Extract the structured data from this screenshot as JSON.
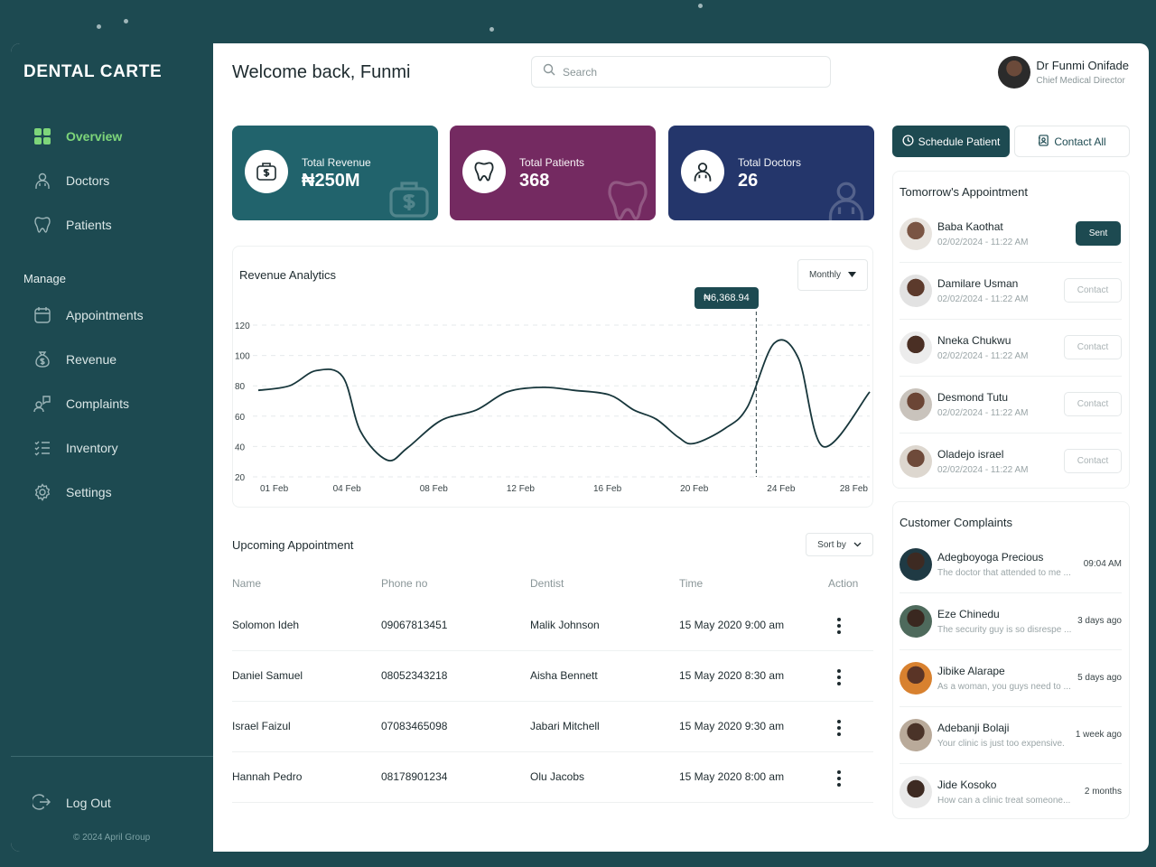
{
  "brand": "DENTAL CARTE",
  "sidebar": {
    "items": [
      {
        "label": "Overview",
        "icon": "grid-icon"
      },
      {
        "label": "Doctors",
        "icon": "doctor-icon"
      },
      {
        "label": "Patients",
        "icon": "tooth-icon"
      }
    ],
    "section_label": "Manage",
    "manage_items": [
      {
        "label": "Appointments",
        "icon": "calendar-icon"
      },
      {
        "label": "Revenue",
        "icon": "money-bag-icon"
      },
      {
        "label": "Complaints",
        "icon": "complaint-icon"
      },
      {
        "label": "Inventory",
        "icon": "list-check-icon"
      },
      {
        "label": "Settings",
        "icon": "gear-icon"
      }
    ],
    "logout": "Log Out",
    "copyright": "© 2024 April Group",
    "active_color": "#7ed67a"
  },
  "header": {
    "welcome": "Welcome back, Funmi",
    "search_placeholder": "Search",
    "user_name": "Dr Funmi Onifade",
    "user_role": "Chief Medical Director"
  },
  "stats": [
    {
      "label": "Total Revenue",
      "value": "₦250M",
      "color": "#21636c",
      "icon": "money-bag-icon"
    },
    {
      "label": "Total Patients",
      "value": "368",
      "color": "#742a61",
      "icon": "tooth-icon"
    },
    {
      "label": "Total Doctors",
      "value": "26",
      "color": "#24366b",
      "icon": "doctor-icon"
    }
  ],
  "revenue": {
    "title": "Revenue Analytics",
    "period": "Monthly",
    "tooltip": "₦6,368.94"
  },
  "chart_data": {
    "type": "line",
    "title": "Revenue Analytics",
    "x_ticks": [
      "01 Feb",
      "04 Feb",
      "08 Feb",
      "12 Feb",
      "16 Feb",
      "20 Feb",
      "24 Feb",
      "28 Feb"
    ],
    "y_ticks": [
      120,
      100,
      80,
      60,
      40,
      20
    ],
    "ylim": [
      20,
      120
    ],
    "x": [
      0,
      1.4,
      2.6,
      3.8,
      4.6,
      5.8,
      6.7,
      8.2,
      9.8,
      11.2,
      12.8,
      14.2,
      15.8,
      16.9,
      17.9,
      18.9,
      19.6,
      21.0,
      22.0,
      23.2,
      24.3,
      25.4,
      27.5
    ],
    "values": [
      77,
      80,
      90,
      86,
      50,
      31,
      39,
      57,
      64,
      76,
      79,
      77,
      74,
      64,
      58,
      46,
      42,
      52,
      66,
      108,
      98,
      40,
      76
    ],
    "highlight_x": 22.4,
    "grid": true
  },
  "upcoming": {
    "title": "Upcoming Appointment",
    "sort_label": "Sort by",
    "columns": [
      "Name",
      "Phone no",
      "Dentist",
      "Time",
      "Action"
    ],
    "rows": [
      {
        "name": "Solomon Ideh",
        "phone": "09067813451",
        "dentist": "Malik Johnson",
        "time": "15 May 2020 9:00 am"
      },
      {
        "name": "Daniel Samuel",
        "phone": "08052343218",
        "dentist": "Aisha Bennett",
        "time": "15 May 2020 8:30 am"
      },
      {
        "name": "Israel Faizul",
        "phone": "07083465098",
        "dentist": "Jabari Mitchell",
        "time": "15 May 2020 9:30 am"
      },
      {
        "name": "Hannah Pedro",
        "phone": "08178901234",
        "dentist": "Olu Jacobs",
        "time": "15 May 2020 8:00 am"
      }
    ]
  },
  "actions": {
    "schedule": "Schedule Patient",
    "contact_all": "Contact All"
  },
  "tomorrow": {
    "title": "Tomorrow's Appointment",
    "items": [
      {
        "name": "Baba Kaothat",
        "time": "02/02/2024 - 11:22 AM",
        "button": "Sent",
        "state": "sent"
      },
      {
        "name": "Damilare Usman",
        "time": "02/02/2024 - 11:22 AM",
        "button": "Contact",
        "state": "contact"
      },
      {
        "name": "Nneka Chukwu",
        "time": "02/02/2024 - 11:22 AM",
        "button": "Contact",
        "state": "contact"
      },
      {
        "name": "Desmond Tutu",
        "time": "02/02/2024 - 11:22 AM",
        "button": "Contact",
        "state": "contact"
      },
      {
        "name": "Oladejo israel",
        "time": "02/02/2024 - 11:22 AM",
        "button": "Contact",
        "state": "contact"
      }
    ]
  },
  "complaints": {
    "title": "Customer Complaints",
    "items": [
      {
        "name": "Adegboyoga Precious",
        "text": "The doctor that attended to me ...",
        "time": "09:04 AM"
      },
      {
        "name": "Eze Chinedu",
        "text": "The security guy is so disrespe ...",
        "time": "3 days ago"
      },
      {
        "name": "Jibike Alarape",
        "text": "As a woman, you guys need to ...",
        "time": "5 days ago"
      },
      {
        "name": "Adebanji Bolaji",
        "text": "Your clinic is just too expensive.",
        "time": "1 week ago"
      },
      {
        "name": "Jide Kosoko",
        "text": "How can a clinic treat someone...",
        "time": "2 months"
      }
    ]
  }
}
